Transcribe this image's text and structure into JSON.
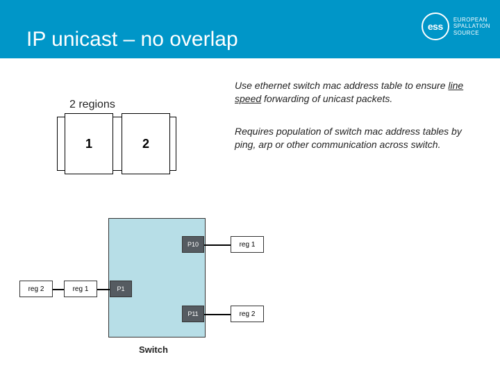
{
  "header": {
    "title": "IP unicast – no overlap",
    "logo_text_l1": "EUROPEAN",
    "logo_text_l2": "SPALLATION",
    "logo_text_l3": "SOURCE",
    "logo_abbrev": "ess"
  },
  "regions": {
    "label": "2 regions",
    "cell1": "1",
    "cell2": "2"
  },
  "description": {
    "para1_pre": "Use ethernet switch mac address table to ensure ",
    "para1_underlined": "line speed",
    "para1_post": " forwarding of unicast packets.",
    "para2": "Requires population of switch mac address tables by ping, arp or other communication across switch."
  },
  "switch": {
    "label": "Switch",
    "ports": {
      "p10": "P10",
      "p01": "P1",
      "p11": "P11"
    }
  },
  "nodes": {
    "left_reg2": "reg 2",
    "left_reg1": "reg 1",
    "right_reg1": "reg 1",
    "right_reg2": "reg 2"
  }
}
